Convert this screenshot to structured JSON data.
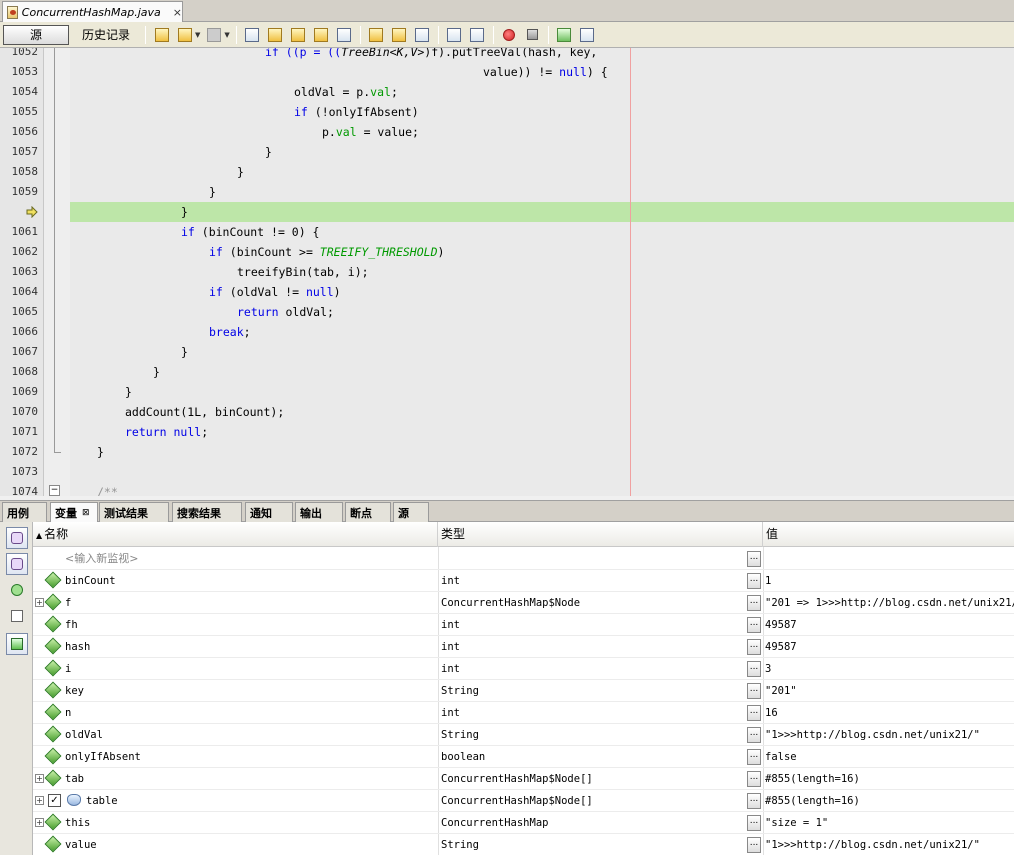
{
  "editor_tab": {
    "filename": "ConcurrentHashMap.java",
    "close": "×"
  },
  "toolbar": {
    "source_label": "源",
    "history_label": "历史记录"
  },
  "code": {
    "lines": [
      {
        "num": "1052",
        "text": ""
      },
      {
        "num": "1053",
        "text": ""
      },
      {
        "num": "1054",
        "text": ""
      },
      {
        "num": "1055",
        "text": ""
      },
      {
        "num": "1056",
        "text": ""
      },
      {
        "num": "1057",
        "text": ""
      },
      {
        "num": "1058",
        "text": ""
      },
      {
        "num": "1059",
        "text": ""
      },
      {
        "num": "",
        "text": ""
      },
      {
        "num": "1061",
        "text": ""
      },
      {
        "num": "1062",
        "text": ""
      },
      {
        "num": "1063",
        "text": ""
      },
      {
        "num": "1064",
        "text": ""
      },
      {
        "num": "1065",
        "text": ""
      },
      {
        "num": "1066",
        "text": ""
      },
      {
        "num": "1067",
        "text": ""
      },
      {
        "num": "1068",
        "text": ""
      },
      {
        "num": "1069",
        "text": ""
      },
      {
        "num": "1070",
        "text": ""
      },
      {
        "num": "1071",
        "text": ""
      },
      {
        "num": "1072",
        "text": ""
      },
      {
        "num": "1073",
        "text": ""
      },
      {
        "num": "1074",
        "text": ""
      }
    ],
    "l1052a": "if ((p = ((",
    "l1052b": "TreeBin<K,V>",
    "l1052c": ")f).putTreeVal(hash, key,",
    "l1053a": "value)) != ",
    "l1053b": "null",
    "l1053c": ") {",
    "l1054a": "oldVal = p.",
    "l1054b": "val",
    "l1054c": ";",
    "l1055a": "if",
    "l1055b": " (!onlyIfAbsent)",
    "l1056a": "p.",
    "l1056b": "val",
    "l1056c": " = value;",
    "l1057": "}",
    "l1058": "}",
    "l1059": "}",
    "l1060": "}",
    "l1061a": "if",
    "l1061b": " (binCount != 0) {",
    "l1062a": "if",
    "l1062b": " (binCount >= ",
    "l1062c": "TREEIFY_THRESHOLD",
    "l1062d": ")",
    "l1063": "treeifyBin(tab, i);",
    "l1064a": "if",
    "l1064b": " (oldVal != ",
    "l1064c": "null",
    "l1064d": ")",
    "l1065a": "return",
    "l1065b": " oldVal;",
    "l1066a": "break",
    "l1066b": ";",
    "l1067": "}",
    "l1068": "}",
    "l1069": "}",
    "l1070": "addCount(1L, binCount);",
    "l1071a": "return",
    "l1071b": " ",
    "l1071c": "null",
    "l1071d": ";",
    "l1072": "}",
    "l1074": "/**",
    "fold_symbol": "−"
  },
  "panel_tabs": [
    {
      "label": "用例"
    },
    {
      "label": "变量",
      "close": "⊠"
    },
    {
      "label": "测试结果"
    },
    {
      "label": "搜索结果"
    },
    {
      "label": "通知"
    },
    {
      "label": "输出"
    },
    {
      "label": "断点"
    },
    {
      "label": "源"
    }
  ],
  "variables": {
    "headers": {
      "name": "名称",
      "type": "类型",
      "value": "值",
      "sort": "▲"
    },
    "new_watch": "<输入新监视>",
    "dots": "...",
    "expand": "+",
    "check": "✓",
    "rows": [
      {
        "name": "binCount",
        "type": "int",
        "value": "1"
      },
      {
        "name": "f",
        "type": "ConcurrentHashMap$Node",
        "value": "\"201 => 1>>>http://blog.csdn.net/unix21/\""
      },
      {
        "name": "fh",
        "type": "int",
        "value": "49587"
      },
      {
        "name": "hash",
        "type": "int",
        "value": "49587"
      },
      {
        "name": "i",
        "type": "int",
        "value": "3"
      },
      {
        "name": "key",
        "type": "String",
        "value": "\"201\""
      },
      {
        "name": "n",
        "type": "int",
        "value": "16"
      },
      {
        "name": "oldVal",
        "type": "String",
        "value": "\"1>>>http://blog.csdn.net/unix21/\""
      },
      {
        "name": "onlyIfAbsent",
        "type": "boolean",
        "value": "false"
      },
      {
        "name": "tab",
        "type": "ConcurrentHashMap$Node[]",
        "value": "#855(length=16)"
      },
      {
        "name": "table",
        "type": "ConcurrentHashMap$Node[]",
        "value": "#855(length=16)"
      },
      {
        "name": "this",
        "type": "ConcurrentHashMap",
        "value": "\"size = 1\""
      },
      {
        "name": "value",
        "type": "String",
        "value": "\"1>>>http://blog.csdn.net/unix21/\""
      }
    ]
  }
}
